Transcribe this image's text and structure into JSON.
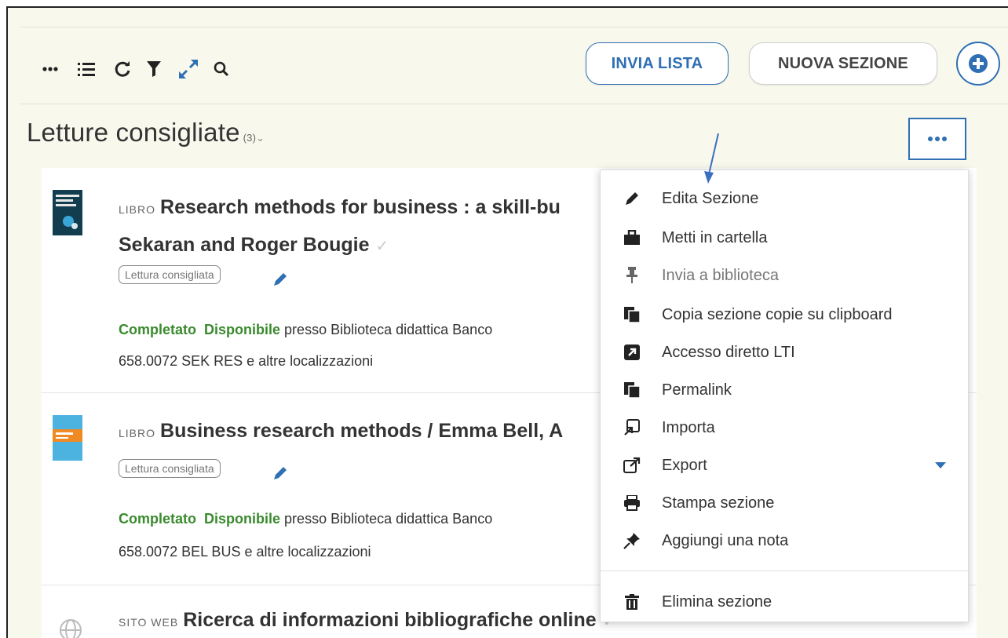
{
  "toolbar": {
    "send_list_label": "INVIA LISTA",
    "new_section_label": "NUOVA SEZIONE"
  },
  "section": {
    "title": "Letture consigliate",
    "count": "(3)",
    "caret": "⌄"
  },
  "items": [
    {
      "kind": "LIBRO",
      "title_line1": "Research methods for business : a skill-bu",
      "title_line2": "Sekaran and Roger Bougie",
      "tag": "Lettura consigliata",
      "status": "Completato",
      "availability": "Disponibile",
      "location": "presso Biblioteca didattica Banco",
      "call_number": "658.0072 SEK RES e altre localizzazioni"
    },
    {
      "kind": "LIBRO",
      "title_line1": "Business research methods / Emma Bell, A",
      "tag": "Lettura consigliata",
      "status": "Completato",
      "availability": "Disponibile",
      "location": "presso Biblioteca didattica Banco",
      "call_number": "658.0072 BEL BUS e altre localizzazioni"
    },
    {
      "kind": "SITO WEB",
      "title_line1": "Ricerca di informazioni bibliografiche online"
    }
  ],
  "menu": {
    "items": [
      {
        "label": "Edita Sezione",
        "icon": "pencil-icon"
      },
      {
        "label": "Metti in cartella",
        "icon": "briefcase-icon"
      },
      {
        "label": "Invia a biblioteca",
        "icon": "pin-icon"
      },
      {
        "label": "Copia sezione copie su clipboard",
        "icon": "copy-icon"
      },
      {
        "label": "Accesso diretto LTI",
        "icon": "external-square-icon"
      },
      {
        "label": "Permalink",
        "icon": "copy-icon"
      },
      {
        "label": "Importa",
        "icon": "import-icon"
      },
      {
        "label": "Export",
        "icon": "external-link-icon"
      },
      {
        "label": "Stampa sezione",
        "icon": "print-icon"
      },
      {
        "label": "Aggiungi una nota",
        "icon": "thumbtack-icon"
      },
      {
        "label": "Elimina sezione",
        "icon": "trash-icon"
      }
    ]
  },
  "colors": {
    "accent": "#2f6fb4",
    "status_green": "#3a8a2e",
    "background": "#f8f8ec"
  }
}
